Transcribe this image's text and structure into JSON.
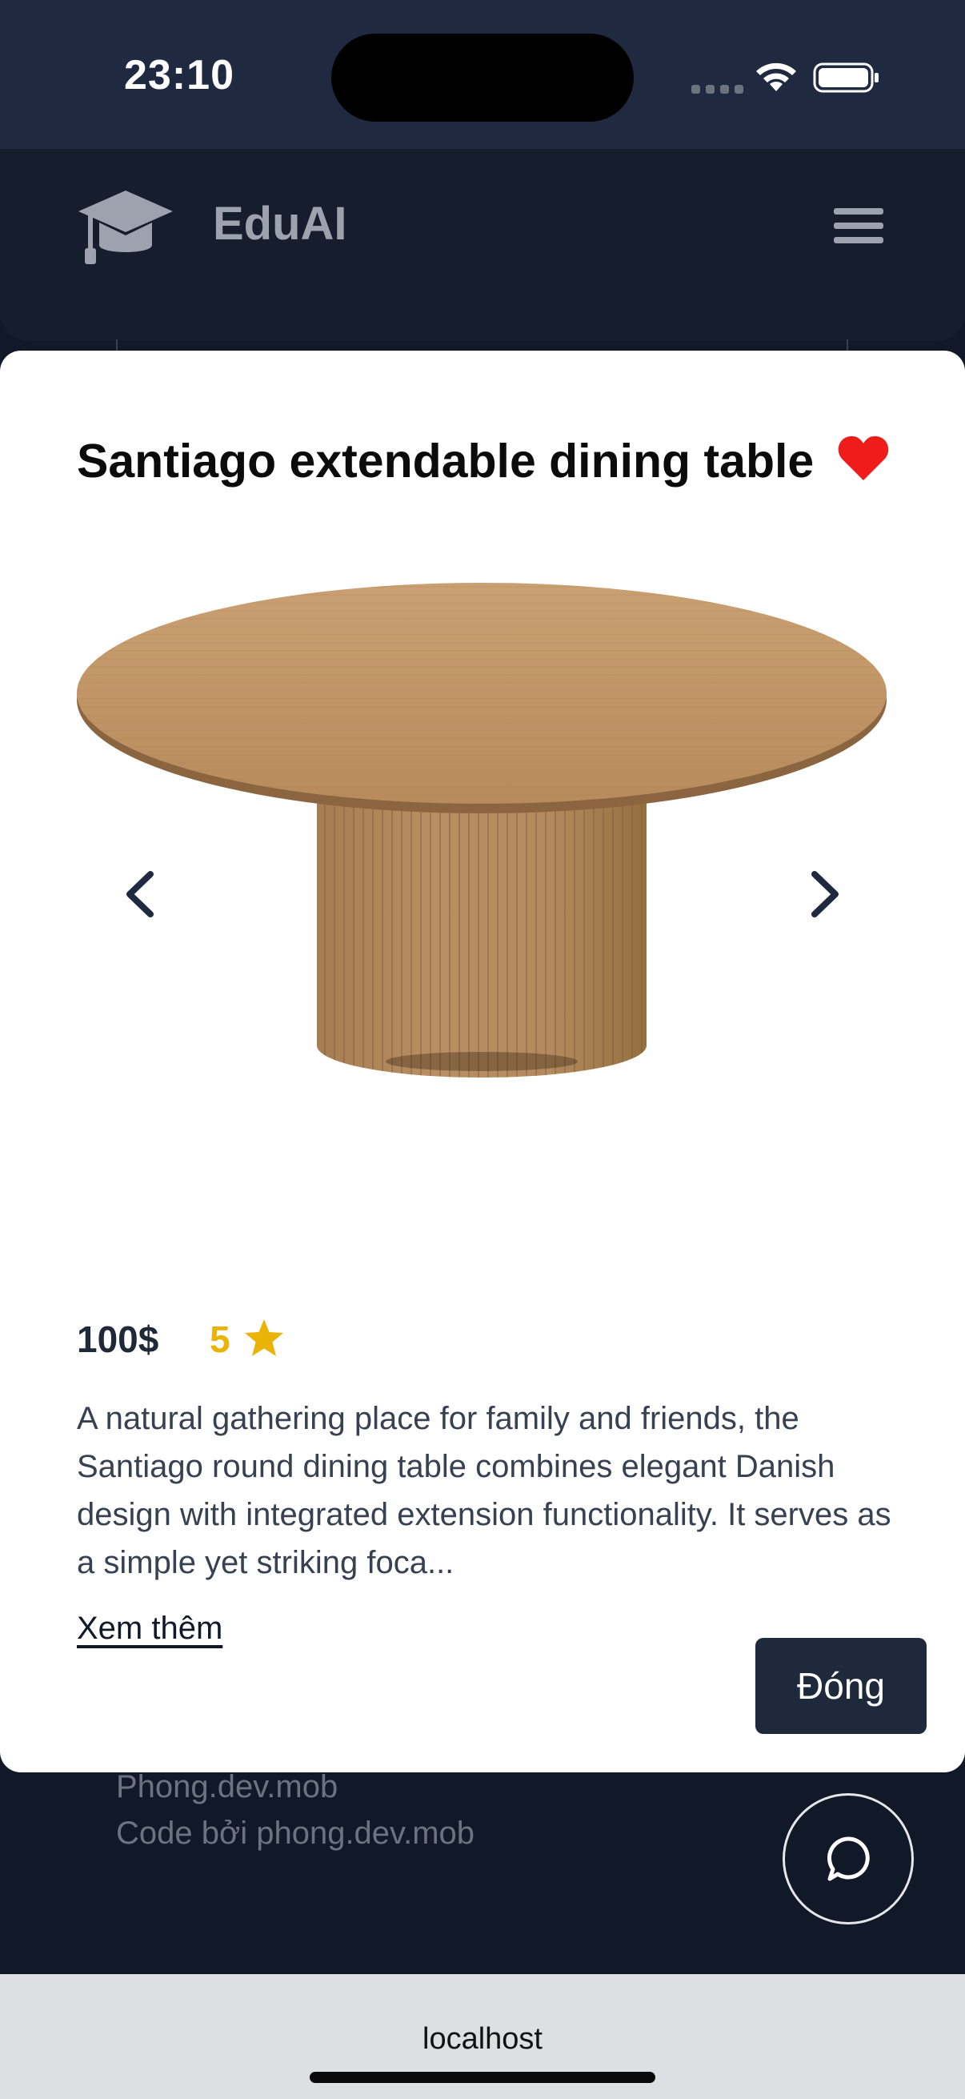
{
  "status_bar": {
    "time": "23:10"
  },
  "header": {
    "brand": "EduAI",
    "logo_icon": "graduation-cap-icon",
    "menu_icon": "hamburger-menu-icon"
  },
  "modal": {
    "title": "Santiago extendable dining table",
    "favorite_icon": "heart-icon",
    "favorite_color": "#ef1c1c",
    "image_alt": "round-wood-pedestal-dining-table",
    "prev_icon": "chevron-left-icon",
    "next_icon": "chevron-right-icon",
    "price": "100$",
    "rating": "5",
    "rating_icon": "star-icon",
    "rating_color": "#eab308",
    "description": "A natural gathering place for family and friends, the Santiago round dining table combines elegant Danish design with integrated extension functionality. It serves as a simple yet striking foca...",
    "see_more_label": "Xem thêm",
    "close_label": "Đóng"
  },
  "footer": {
    "line1": "Phong.dev.mob",
    "line2": "Code bởi phong.dev.mob",
    "chat_icon": "chat-bubble-icon"
  },
  "browser": {
    "url": "localhost"
  }
}
